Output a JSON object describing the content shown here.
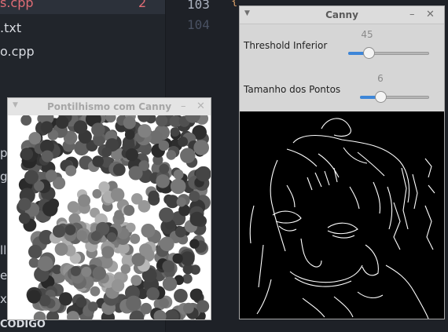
{
  "editor": {
    "files": [
      {
        "label": "s.cpp",
        "badge": "2",
        "active": true
      },
      {
        "label": ".txt",
        "badge": "",
        "active": false
      },
      {
        "label": "o.cpp",
        "badge": "",
        "active": false
      }
    ],
    "side_chars": [
      "p",
      "g",
      "ll",
      "e.",
      "x"
    ],
    "footer": "CODIGO",
    "line_numbers": [
      "103",
      "104"
    ],
    "code_snippet": "{"
  },
  "pontilhismo_window": {
    "title": "Pontilhismo com Canny"
  },
  "canny_window": {
    "title": "Canny",
    "trackbars": [
      {
        "label": "Threshold Inferior",
        "value": "45",
        "fraction": 0.25
      },
      {
        "label": "Tamanho dos Pontos",
        "value": "6",
        "fraction": 0.3
      }
    ]
  },
  "window_controls": {
    "menu_icon": "chevron-down-icon",
    "minimize_icon": "minimize-icon",
    "close_icon": "close-icon"
  },
  "colors": {
    "slider_fill": "#3d86d8",
    "badge": "#e06c75"
  }
}
